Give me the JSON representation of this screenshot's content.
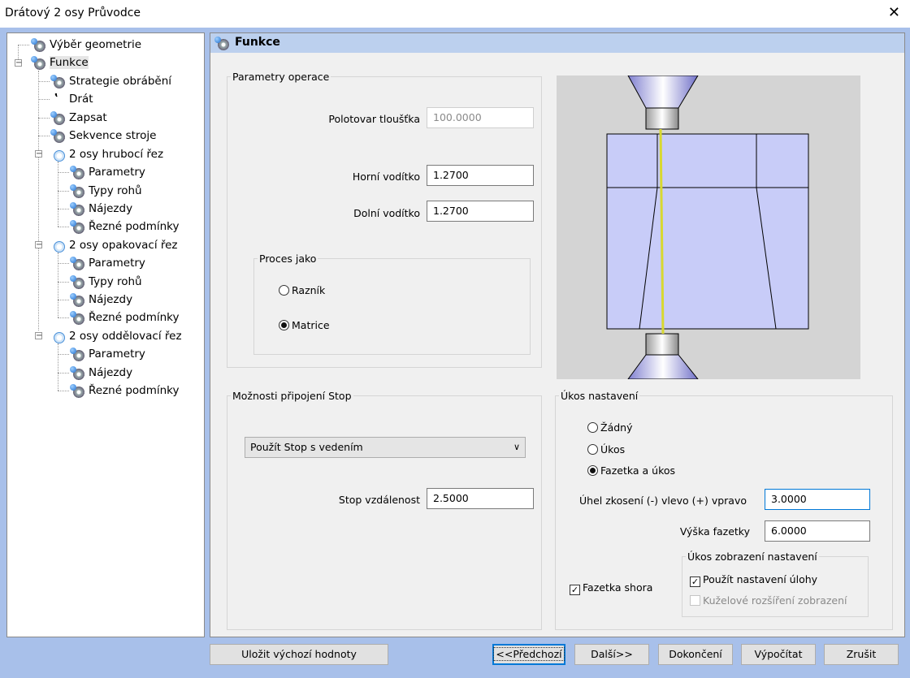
{
  "window": {
    "title": "Drátový 2 osy Průvodce",
    "close": "✕"
  },
  "tree": {
    "items": [
      {
        "label": "Výběr geometrie"
      },
      {
        "label": "Funkce"
      },
      {
        "label": "Strategie obrábění"
      },
      {
        "label": "Drát"
      },
      {
        "label": "Zapsat"
      },
      {
        "label": "Sekvence stroje"
      },
      {
        "label": "2 osy hrubocí řez"
      },
      {
        "label": "Parametry"
      },
      {
        "label": "Typy rohů"
      },
      {
        "label": "Nájezdy"
      },
      {
        "label": "Řezné podmínky"
      },
      {
        "label": "2 osy opakovací řez"
      },
      {
        "label": "Parametry"
      },
      {
        "label": "Typy rohů"
      },
      {
        "label": "Nájezdy"
      },
      {
        "label": "Řezné podmínky"
      },
      {
        "label": "2 osy oddělovací řez"
      },
      {
        "label": "Parametry"
      },
      {
        "label": "Nájezdy"
      },
      {
        "label": "Řezné podmínky"
      }
    ],
    "expander_minus": "−"
  },
  "panel": {
    "title": "Funkce",
    "operation": {
      "legend": "Parametry operace",
      "blank_label": "Polotovar tloušťka",
      "blank_value": "100.0000",
      "upper_label": "Horní vodítko",
      "upper_value": "1.2700",
      "lower_label": "Dolní vodítko",
      "lower_value": "1.2700",
      "process": {
        "legend": "Proces jako",
        "punch": "Razník",
        "die": "Matrice",
        "selected": "Matrice"
      }
    },
    "stop": {
      "legend": "Možnosti připojení Stop",
      "combo_value": "Použít Stop s vedením",
      "distance_label": "Stop vzdálenost",
      "distance_value": "2.5000"
    },
    "taper": {
      "legend": "Úkos nastavení",
      "opt_none": "Žádný",
      "opt_taper": "Úkos",
      "opt_land": "Fazetka a úkos",
      "selected": "Fazetka a úkos",
      "angle_label": "Úhel zkosení  (-) vlevo (+) vpravo",
      "angle_value": "3.0000",
      "land_height_label": "Výška fazetky",
      "land_height_value": "6.0000",
      "land_top_label": "Fazetka shora",
      "land_top_checked": true,
      "display": {
        "legend": "Úkos zobrazení nastavení",
        "use_task": "Použít nastavení úlohy",
        "use_task_checked": true,
        "conical": "Kuželové rozšíření zobrazení",
        "conical_checked": false
      }
    },
    "check_mark": "✓"
  },
  "buttons": {
    "save_defaults": "Uložit výchozí hodnoty",
    "prev": "<<Předchozí",
    "next": "Další>>",
    "finish": "Dokončení",
    "calculate": "Výpočítat",
    "cancel": "Zrušit"
  },
  "colors": {
    "accent_blue": "#a8c0ea",
    "header_blue": "#bcd0ee",
    "preview_fill": "#c8ccf8",
    "wire": "#d8d830"
  }
}
